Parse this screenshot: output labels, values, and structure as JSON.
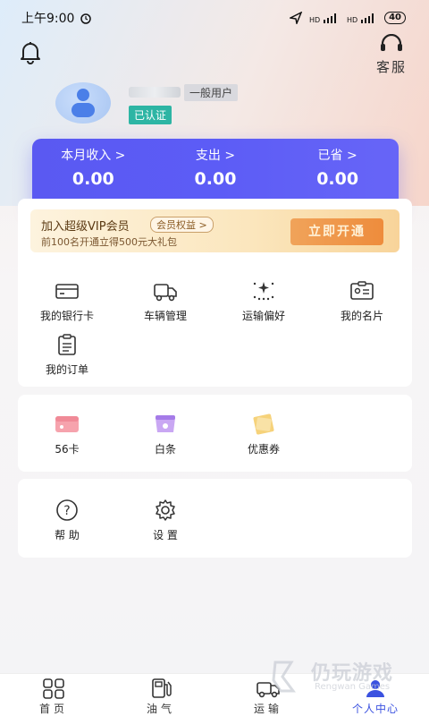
{
  "status_bar": {
    "time": "上午9:00",
    "battery": "40"
  },
  "header": {
    "service_label": "客服"
  },
  "user": {
    "level": "一般用户",
    "verified": "已认证"
  },
  "stats": [
    {
      "label": "本月收入 >",
      "value": "0.00"
    },
    {
      "label": "支出 >",
      "value": "0.00"
    },
    {
      "label": "已省 >",
      "value": "0.00"
    }
  ],
  "vip": {
    "title": "加入超级VIP会员",
    "tag": "会员权益 >",
    "subtitle": "前100名开通立得500元大礼包",
    "button": "立即开通"
  },
  "features": [
    {
      "label": "我的银行卡",
      "icon": "bank-card-icon"
    },
    {
      "label": "车辆管理",
      "icon": "truck-icon"
    },
    {
      "label": "运输偏好",
      "icon": "sparkle-grid-icon"
    },
    {
      "label": "我的名片",
      "icon": "id-card-icon"
    },
    {
      "label": "我的订单",
      "icon": "clipboard-icon"
    }
  ],
  "services": [
    {
      "label": "56卡",
      "icon": "card-56-icon"
    },
    {
      "label": "白条",
      "icon": "credit-icon"
    },
    {
      "label": "优惠券",
      "icon": "coupon-icon"
    }
  ],
  "help": [
    {
      "label": "帮 助",
      "icon": "help-icon"
    },
    {
      "label": "设 置",
      "icon": "settings-icon"
    }
  ],
  "bottom_nav": [
    {
      "label": "首页",
      "icon": "home-grid-icon"
    },
    {
      "label": "油气",
      "icon": "fuel-icon"
    },
    {
      "label": "运输",
      "icon": "transport-truck-icon"
    },
    {
      "label": "个人中心",
      "icon": "profile-icon",
      "active": true
    }
  ],
  "watermark": {
    "text": "仍玩游戏",
    "sub": "Rengwan Games"
  },
  "colors": {
    "accent": "#5b5af3",
    "verified": "#2db5a4",
    "vip_button": "#ee8c3c"
  }
}
